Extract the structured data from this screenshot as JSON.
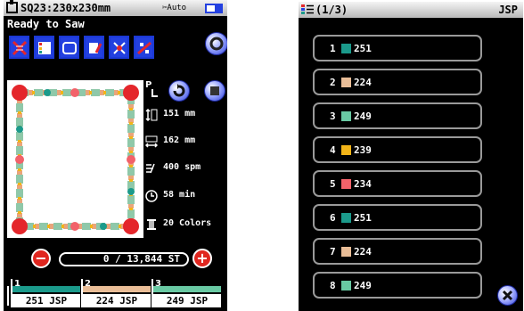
{
  "left": {
    "title": "SQ23:230x230mm",
    "mode": "Auto",
    "status": "Ready to Saw",
    "info": {
      "height": "151 mm",
      "width": "162 mm",
      "speed": "400 spm",
      "time": "58 min",
      "colors": "20 Colors"
    },
    "stitch_counter": "0 / 13,844 ST",
    "threads": [
      {
        "index": "1",
        "label": "251 JSP",
        "color": "#1b9a8b"
      },
      {
        "index": "2",
        "label": "224 JSP",
        "color": "#e9bd97"
      },
      {
        "index": "3",
        "label": "249 JSP",
        "color": "#69c9a3"
      }
    ],
    "minus_label": "−",
    "plus_label": "+"
  },
  "right": {
    "title": "(1/3)",
    "brand": "JSP",
    "items": [
      {
        "n": "1",
        "v": "251",
        "color": "#1b9a8b"
      },
      {
        "n": "2",
        "v": "224",
        "color": "#e9bd97"
      },
      {
        "n": "3",
        "v": "249",
        "color": "#69c9a3"
      },
      {
        "n": "4",
        "v": "239",
        "color": "#f2b418"
      },
      {
        "n": "5",
        "v": "234",
        "color": "#f2626a"
      },
      {
        "n": "6",
        "v": "251",
        "color": "#1b9a8b"
      },
      {
        "n": "7",
        "v": "224",
        "color": "#e9bd97"
      },
      {
        "n": "8",
        "v": "249",
        "color": "#69c9a3"
      }
    ]
  }
}
